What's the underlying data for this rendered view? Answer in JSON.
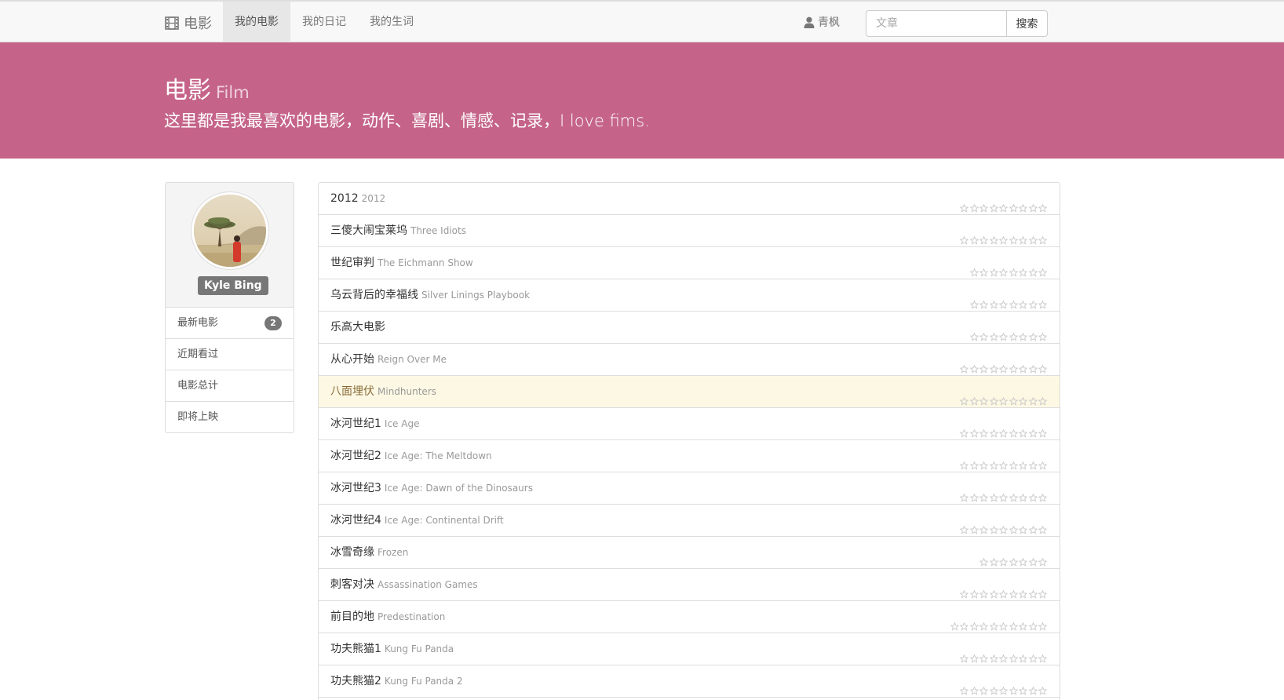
{
  "navbar": {
    "brand_icon": "film-icon",
    "brand": "电影",
    "items": [
      {
        "label": "我的电影",
        "active": true
      },
      {
        "label": "我的日记",
        "active": false
      },
      {
        "label": "我的生词",
        "active": false
      }
    ],
    "user_icon": "user-icon",
    "user": "青枫",
    "search_placeholder": "文章",
    "search_button": "搜索"
  },
  "jumbotron": {
    "title": "电影",
    "subtitle": "Film",
    "description": "这里都是我最喜欢的电影，动作、喜剧、情感、记录，I love fims.",
    "background": "#c56488"
  },
  "sidebar": {
    "name": "Kyle Bing",
    "menu": [
      {
        "label": "最新电影",
        "badge": "2"
      },
      {
        "label": "近期看过",
        "badge": ""
      },
      {
        "label": "电影总计",
        "badge": ""
      },
      {
        "label": "即将上映",
        "badge": ""
      }
    ]
  },
  "movies": [
    {
      "title": "2012",
      "en": "2012",
      "stars": 9
    },
    {
      "title": "三傻大闹宝莱坞",
      "en": "Three Idiots",
      "stars": 9
    },
    {
      "title": "世纪审判",
      "en": "The Eichmann Show",
      "stars": 8
    },
    {
      "title": "乌云背后的幸福线",
      "en": "Silver Linings Playbook",
      "stars": 8
    },
    {
      "title": "乐高大电影",
      "en": "",
      "stars": 8
    },
    {
      "title": "从心开始",
      "en": "Reign Over Me",
      "stars": 9
    },
    {
      "title": "八面埋伏",
      "en": "Mindhunters",
      "stars": 9,
      "highlight": true
    },
    {
      "title": "冰河世纪1",
      "en": "Ice Age",
      "stars": 9
    },
    {
      "title": "冰河世纪2",
      "en": "Ice Age: The Meltdown",
      "stars": 9
    },
    {
      "title": "冰河世纪3",
      "en": "Ice Age: Dawn of the Dinosaurs",
      "stars": 9
    },
    {
      "title": "冰河世纪4",
      "en": "Ice Age: Continental Drift",
      "stars": 9
    },
    {
      "title": "冰雪奇缘",
      "en": "Frozen",
      "stars": 7
    },
    {
      "title": "刺客对决",
      "en": "Assassination Games",
      "stars": 9
    },
    {
      "title": "前目的地",
      "en": "Predestination",
      "stars": 10
    },
    {
      "title": "功夫熊猫1",
      "en": "Kung Fu Panda",
      "stars": 9
    },
    {
      "title": "功夫熊猫2",
      "en": "Kung Fu Panda 2",
      "stars": 9
    }
  ]
}
